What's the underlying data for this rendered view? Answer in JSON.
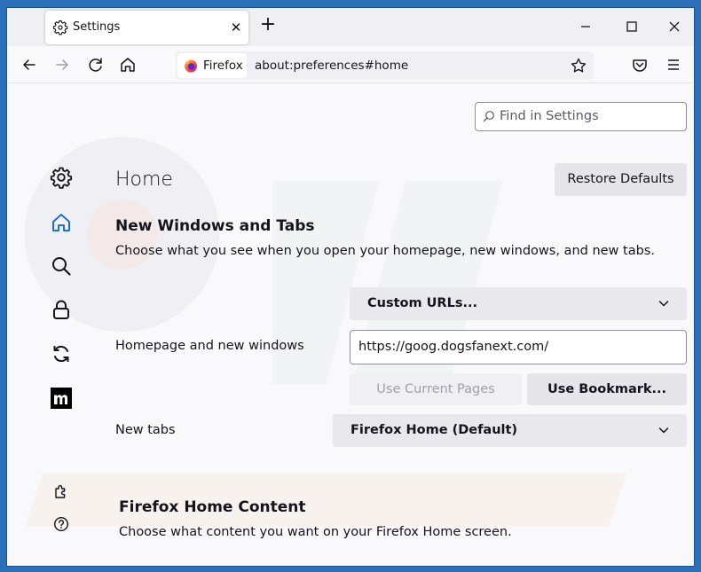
{
  "tab": {
    "title": "Settings",
    "close_glyph": "✕",
    "icon": "gear-icon"
  },
  "newtab_glyph": "+",
  "urlbar": {
    "identity_label": "Firefox",
    "url": "about:preferences#home"
  },
  "search": {
    "placeholder": "Find in Settings"
  },
  "sidebar": {
    "items": [
      {
        "icon": "gear-icon",
        "name": "General"
      },
      {
        "icon": "home-icon",
        "name": "Home",
        "selected": true
      },
      {
        "icon": "search-icon",
        "name": "Search"
      },
      {
        "icon": "lock-icon",
        "name": "Privacy & Security"
      },
      {
        "icon": "sync-icon",
        "name": "Sync"
      },
      {
        "icon": "mozilla-m-icon",
        "name": "More from Mozilla"
      },
      {
        "icon": "puzzle-icon",
        "name": "Extensions & Themes"
      },
      {
        "icon": "help-icon",
        "name": "Firefox Support"
      }
    ]
  },
  "page": {
    "title": "Home",
    "restore_label": "Restore Defaults",
    "new_windows": {
      "heading": "New Windows and Tabs",
      "description": "Choose what you see when you open your homepage, new windows, and new tabs.",
      "homepage_select": "Custom URLs...",
      "homepage_label": "Homepage and new windows",
      "homepage_url": "https://goog.dogsfanext.com/",
      "use_current_label": "Use Current Pages",
      "use_bookmark_label": "Use Bookmark...",
      "newtabs_label": "New tabs",
      "newtabs_select": "Firefox Home (Default)"
    },
    "home_content": {
      "heading": "Firefox Home Content",
      "description": "Choose what content you want on your Firefox Home screen."
    }
  },
  "colors": {
    "accent": "#0061e0",
    "frame": "#2a6fb8",
    "button_bg": "#e5e5ea"
  }
}
